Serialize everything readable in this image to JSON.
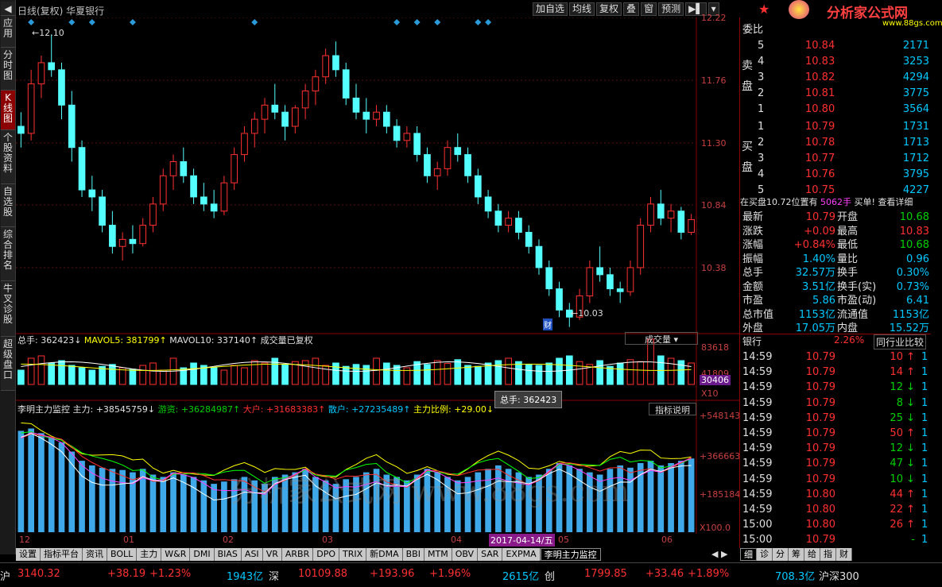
{
  "leftbar": [
    "应用",
    "分时图",
    "K线图",
    "个股资料",
    "自选股",
    "综合排名",
    "牛叉诊股",
    "超级盘口"
  ],
  "title": "日线(复权) 华夏银行",
  "tools": [
    "加自选",
    "均线",
    "复权",
    "叠",
    "窗",
    "预测"
  ],
  "price_axis": [
    "12.22",
    "11.76",
    "11.30",
    "10.84",
    "10.38"
  ],
  "hi_label": "12.10",
  "lo_label": "10.03",
  "fin_tag": "财",
  "vol_header": {
    "a": "总手: 362423↓",
    "b": "MAVOL5: 381799↑",
    "c": "MAVOL10: 337140↑",
    "d": "成交量已复权",
    "sel": "成交量"
  },
  "vol_axis": [
    "83618",
    "41809",
    "30406",
    "X10"
  ],
  "tooltip": "总手: 362423",
  "ind_header": {
    "name": "李明主力监控",
    "a": "主力: +38545759↓",
    "b": "游资: +36284987↑",
    "c": "大户: +31683383↑",
    "d": "散户: +27235489↑",
    "e": "主力比例: +29.00↓",
    "btn": "指标说明"
  },
  "ind_axis": [
    "+548143",
    "+366663",
    "+185184",
    "X100.0"
  ],
  "x_axis": [
    "12",
    "01",
    "02",
    "03",
    "04",
    "05",
    "06"
  ],
  "date_tag": "2017-04-14/五",
  "watermark": "分析家公式网 www.88gs.com",
  "logo": {
    "text": "分析家公式网",
    "url": "www.88gs.com"
  },
  "right": {
    "weibi": "委比",
    "sell": [
      [
        "5",
        "10.84",
        "2171"
      ],
      [
        "4",
        "10.83",
        "3253"
      ],
      [
        "3",
        "10.82",
        "4294"
      ],
      [
        "2",
        "10.81",
        "3775"
      ],
      [
        "1",
        "10.80",
        "3564"
      ]
    ],
    "buy": [
      [
        "1",
        "10.79",
        "1731"
      ],
      [
        "2",
        "10.78",
        "1713"
      ],
      [
        "3",
        "10.77",
        "1712"
      ],
      [
        "4",
        "10.76",
        "3795"
      ],
      [
        "5",
        "10.75",
        "4227"
      ]
    ],
    "sell_lbl": "卖盘",
    "buy_lbl": "买盘",
    "notice": "在买盘10.72位置有",
    "notice_vol": "5062手",
    "notice_act": "买单! 查看详细",
    "stats": [
      [
        "最新",
        "10.79",
        "开盘",
        "10.68"
      ],
      [
        "涨跌",
        "+0.09",
        "最高",
        "10.83"
      ],
      [
        "涨幅",
        "+0.84%",
        "最低",
        "10.68"
      ],
      [
        "振幅",
        "1.40%",
        "量比",
        "0.96"
      ],
      [
        "总手",
        "32.57万",
        "换手",
        "0.30%"
      ],
      [
        "金额",
        "3.51亿",
        "换手(实)",
        "0.73%"
      ],
      [
        "市盈",
        "5.86",
        "市盈(动)",
        "6.41"
      ],
      [
        "总市值",
        "1153亿",
        "流通值",
        "1153亿"
      ],
      [
        "外盘",
        "17.05万",
        "内盘",
        "15.52万"
      ]
    ],
    "industry": [
      "银行",
      "2.26%",
      "同行业比较"
    ],
    "ticks": [
      [
        "14:59",
        "10.79",
        "10",
        "up"
      ],
      [
        "14:59",
        "10.79",
        "14",
        "up"
      ],
      [
        "14:59",
        "10.79",
        "12",
        "dn"
      ],
      [
        "14:59",
        "10.79",
        "8",
        "dn"
      ],
      [
        "14:59",
        "10.79",
        "25",
        "dn"
      ],
      [
        "14:59",
        "10.79",
        "50",
        "up"
      ],
      [
        "14:59",
        "10.79",
        "12",
        "dn"
      ],
      [
        "14:59",
        "10.79",
        "47",
        "dn"
      ],
      [
        "14:59",
        "10.79",
        "10",
        "dn"
      ],
      [
        "14:59",
        "10.80",
        "44",
        "up"
      ],
      [
        "14:59",
        "10.80",
        "22",
        "up"
      ],
      [
        "15:00",
        "10.80",
        "26",
        "up"
      ],
      [
        "15:00",
        "10.79",
        "-",
        ""
      ]
    ],
    "rtabs": [
      "细",
      "诊",
      "分",
      "筹",
      "给",
      "指",
      "财"
    ]
  },
  "tabs": [
    "设置",
    "指标平台",
    "资讯",
    "BOLL",
    "主力",
    "W&R",
    "DMI",
    "BIAS",
    "ASI",
    "VR",
    "ARBR",
    "DPO",
    "TRIX",
    "新DMA",
    "BBI",
    "MTM",
    "OBV",
    "SAR",
    "EXPMA",
    "李明主力监控"
  ],
  "status": [
    [
      "沪",
      "3140.32",
      "+38.19",
      "+1.23%",
      "1943亿"
    ],
    [
      "深",
      "10109.88",
      "+193.96",
      "+1.96%",
      "2615亿"
    ],
    [
      "创",
      "1799.85",
      "+33.46",
      "+1.89%",
      "708.3亿"
    ],
    [
      "沪深300",
      "",
      "",
      "",
      ""
    ]
  ],
  "chart_data": {
    "type": "candlestick",
    "candles": [
      [
        11.45,
        11.55,
        11.3,
        11.4
      ],
      [
        11.4,
        11.85,
        11.35,
        11.75
      ],
      [
        11.75,
        11.95,
        11.65,
        11.9
      ],
      [
        11.9,
        12.1,
        11.8,
        11.85
      ],
      [
        11.85,
        11.9,
        11.5,
        11.6
      ],
      [
        11.6,
        11.7,
        11.2,
        11.3
      ],
      [
        11.3,
        11.35,
        10.95,
        11.0
      ],
      [
        11.0,
        11.1,
        10.85,
        10.95
      ],
      [
        10.95,
        11.0,
        10.7,
        10.75
      ],
      [
        10.75,
        10.85,
        10.55,
        10.6
      ],
      [
        10.6,
        10.7,
        10.5,
        10.65
      ],
      [
        10.65,
        10.75,
        10.55,
        10.62
      ],
      [
        10.62,
        10.8,
        10.6,
        10.75
      ],
      [
        10.75,
        10.95,
        10.7,
        10.9
      ],
      [
        10.9,
        11.15,
        10.85,
        11.1
      ],
      [
        11.1,
        11.25,
        11.0,
        11.2
      ],
      [
        11.2,
        11.3,
        11.05,
        11.1
      ],
      [
        11.1,
        11.15,
        10.9,
        10.95
      ],
      [
        10.95,
        11.05,
        10.85,
        10.9
      ],
      [
        10.9,
        11.0,
        10.8,
        10.85
      ],
      [
        10.85,
        11.1,
        10.82,
        11.05
      ],
      [
        11.05,
        11.3,
        11.0,
        11.25
      ],
      [
        11.25,
        11.45,
        11.2,
        11.4
      ],
      [
        11.4,
        11.55,
        11.3,
        11.5
      ],
      [
        11.5,
        11.65,
        11.4,
        11.6
      ],
      [
        11.6,
        11.75,
        11.5,
        11.55
      ],
      [
        11.55,
        11.6,
        11.35,
        11.45
      ],
      [
        11.45,
        11.6,
        11.4,
        11.58
      ],
      [
        11.58,
        11.75,
        11.5,
        11.7
      ],
      [
        11.7,
        11.85,
        11.6,
        11.8
      ],
      [
        11.8,
        12.0,
        11.75,
        11.95
      ],
      [
        11.95,
        12.05,
        11.8,
        11.85
      ],
      [
        11.85,
        11.9,
        11.6,
        11.65
      ],
      [
        11.65,
        11.75,
        11.5,
        11.55
      ],
      [
        11.55,
        11.65,
        11.4,
        11.5
      ],
      [
        11.5,
        11.6,
        11.45,
        11.55
      ],
      [
        11.55,
        11.6,
        11.4,
        11.45
      ],
      [
        11.45,
        11.5,
        11.3,
        11.35
      ],
      [
        11.35,
        11.45,
        11.3,
        11.4
      ],
      [
        11.4,
        11.45,
        11.2,
        11.25
      ],
      [
        11.25,
        11.3,
        11.05,
        11.1
      ],
      [
        11.1,
        11.2,
        11.0,
        11.15
      ],
      [
        11.15,
        11.35,
        11.1,
        11.3
      ],
      [
        11.3,
        11.4,
        11.2,
        11.25
      ],
      [
        11.25,
        11.3,
        11.05,
        11.1
      ],
      [
        11.1,
        11.15,
        10.9,
        10.95
      ],
      [
        10.95,
        11.0,
        10.8,
        10.85
      ],
      [
        10.85,
        10.9,
        10.7,
        10.75
      ],
      [
        10.75,
        10.85,
        10.7,
        10.8
      ],
      [
        10.8,
        10.85,
        10.65,
        10.7
      ],
      [
        10.7,
        10.75,
        10.55,
        10.6
      ],
      [
        10.6,
        10.65,
        10.4,
        10.45
      ],
      [
        10.45,
        10.5,
        10.25,
        10.3
      ],
      [
        10.3,
        10.35,
        10.1,
        10.15
      ],
      [
        10.15,
        10.2,
        10.03,
        10.1
      ],
      [
        10.1,
        10.3,
        10.08,
        10.25
      ],
      [
        10.25,
        10.5,
        10.2,
        10.45
      ],
      [
        10.45,
        10.6,
        10.35,
        10.4
      ],
      [
        10.4,
        10.45,
        10.25,
        10.3
      ],
      [
        10.3,
        10.35,
        10.2,
        10.28
      ],
      [
        10.28,
        10.5,
        10.25,
        10.45
      ],
      [
        10.45,
        10.8,
        10.4,
        10.75
      ],
      [
        10.75,
        10.95,
        10.7,
        10.9
      ],
      [
        10.9,
        11.0,
        10.75,
        10.8
      ],
      [
        10.8,
        10.9,
        10.7,
        10.85
      ],
      [
        10.85,
        10.88,
        10.65,
        10.7
      ],
      [
        10.7,
        10.83,
        10.68,
        10.79
      ]
    ],
    "vol_fill": [
      0.3,
      0.55,
      0.6,
      0.45,
      0.5,
      0.4,
      0.35,
      0.3,
      0.38,
      0.42,
      0.35,
      0.32,
      0.4,
      0.45,
      0.3,
      0.55,
      0.35,
      0.45,
      0.4,
      0.35,
      0.3,
      0.4,
      0.35,
      0.5,
      0.45,
      0.55,
      0.42,
      0.48,
      0.5,
      0.55,
      0.4,
      0.45,
      0.38,
      0.42,
      0.4,
      0.55,
      0.45,
      0.4,
      0.35,
      0.48,
      0.42,
      0.5,
      0.44,
      0.52,
      0.4,
      0.38,
      0.45,
      0.5,
      0.55,
      0.48,
      0.42,
      0.4,
      0.45,
      0.55,
      0.6,
      0.48,
      0.42,
      0.5,
      0.38,
      0.45,
      0.52,
      0.48,
      0.95,
      0.6,
      0.55,
      0.5,
      0.45
    ],
    "ind_fill": [
      0.88,
      0.9,
      0.86,
      0.82,
      0.78,
      0.7,
      0.62,
      0.58,
      0.56,
      0.55,
      0.54,
      0.52,
      0.55,
      0.5,
      0.48,
      0.52,
      0.5,
      0.48,
      0.45,
      0.42,
      0.44,
      0.46,
      0.48,
      0.45,
      0.42,
      0.48,
      0.5,
      0.52,
      0.55,
      0.48,
      0.45,
      0.42,
      0.46,
      0.48,
      0.52,
      0.55,
      0.5,
      0.48,
      0.45,
      0.5,
      0.55,
      0.52,
      0.48,
      0.45,
      0.48,
      0.52,
      0.55,
      0.58,
      0.55,
      0.52,
      0.48,
      0.5,
      0.55,
      0.6,
      0.58,
      0.55,
      0.52,
      0.5,
      0.55,
      0.58,
      0.56,
      0.6,
      0.62,
      0.58,
      0.6,
      0.62,
      0.64
    ]
  }
}
